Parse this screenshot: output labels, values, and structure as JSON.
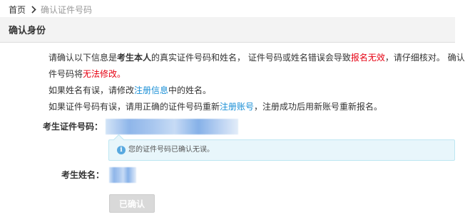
{
  "breadcrumb": {
    "home": "首页",
    "current": "确认证件号码"
  },
  "section": {
    "title": "确认身份"
  },
  "notice": {
    "line1_part1": "请确认以下信息是",
    "line1_bold": "考生本人",
    "line1_part2": "的真实证件号码和姓名，  证件号码或姓名错误会导致",
    "line1_red": "报名无效",
    "line1_part3": "，请仔细核对。  确认后证",
    "line2_part1": "件号码将",
    "line2_red": "无法修改。",
    "line3_part1": "如果姓名有误，请修改",
    "line3_link": "注册信息",
    "line3_part2": "中的姓名。",
    "line4_part1": "如果证件号码有误，请用正确的证件号码重新",
    "line4_link": "注册账号",
    "line4_part2": "，注册成功后用新账号重新报名。"
  },
  "form": {
    "id_label": "考生证件号码：",
    "name_label": "考生姓名：",
    "info_message": "您的证件号码已确认无误。",
    "confirm_button": "已确认"
  },
  "colors": {
    "red": "#e60012",
    "link": "#1a8fd6",
    "header_bg": "#f3f3f3",
    "info_bg": "#e8f6fb"
  },
  "icons": {
    "breadcrumb_separator": "chevron-right-icon",
    "info": "info-icon"
  }
}
